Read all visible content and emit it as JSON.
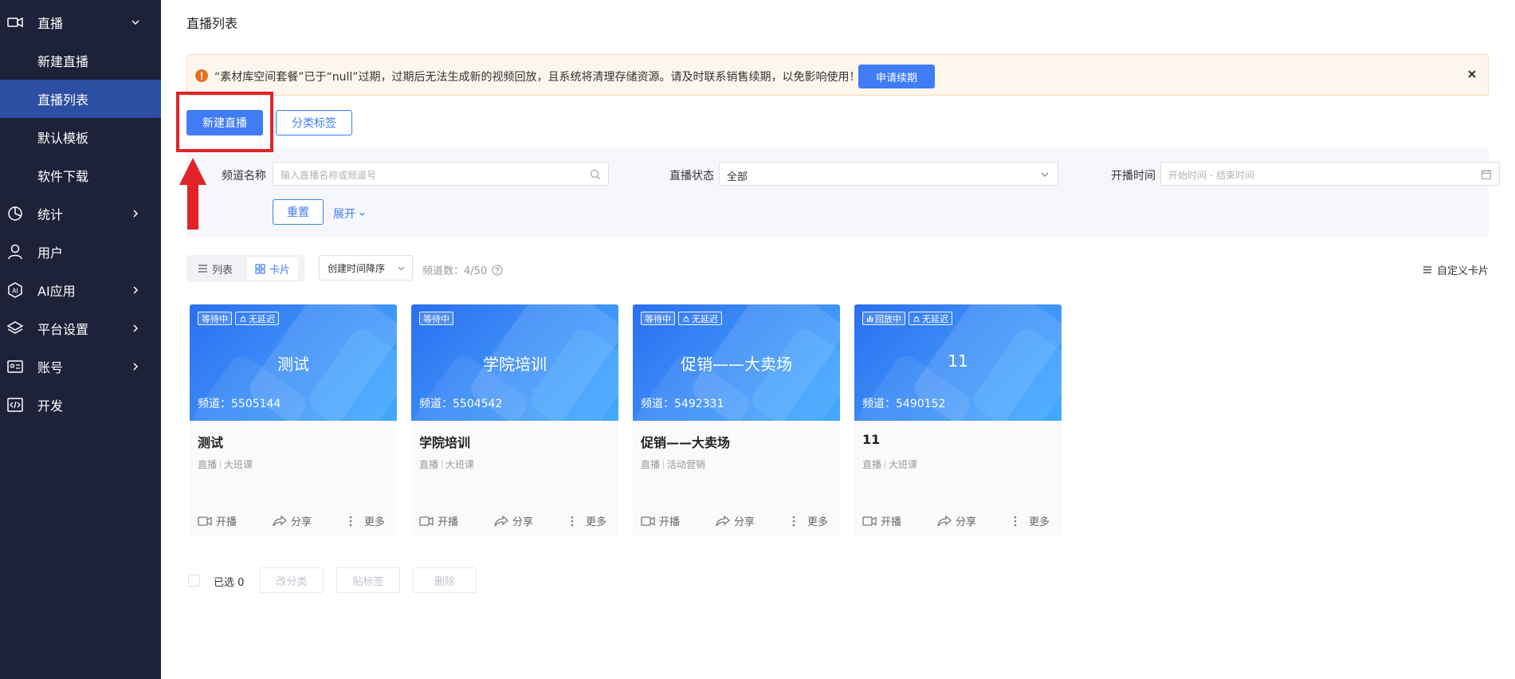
{
  "sidebar": {
    "items": [
      {
        "label": "直播",
        "icon": "video-camera-icon"
      },
      {
        "label": "新建直播"
      },
      {
        "label": "直播列表",
        "active": true
      },
      {
        "label": "默认模板"
      },
      {
        "label": "软件下载"
      },
      {
        "label": "统计",
        "icon": "pie-chart-icon"
      },
      {
        "label": "用户",
        "icon": "user-icon"
      },
      {
        "label": "AI应用",
        "icon": "ai-hexagon-icon"
      },
      {
        "label": "平台设置",
        "icon": "layers-icon"
      },
      {
        "label": "账号",
        "icon": "id-card-icon"
      },
      {
        "label": "开发",
        "icon": "code-icon"
      }
    ]
  },
  "page": {
    "title": "直播列表"
  },
  "alert": {
    "text": "“素材库空间套餐”已于“null”过期，过期后无法生成新的视频回放，且系统将清理存储资源。请及时联系销售续期，以免影响使用！",
    "renew_label": "申请续期",
    "close_icon": "close-icon"
  },
  "actions": {
    "new_live_label": "新建直播",
    "category_tags_label": "分类标签"
  },
  "filter": {
    "channel_name_label": "频道名称",
    "channel_name_placeholder": "输入直播名称或频道号",
    "status_label": "直播状态",
    "status_value": "全部",
    "start_time_label": "开播时间",
    "start_time_placeholder": "开始时间 - 结束时间",
    "reset_label": "重置",
    "expand_label": "展开"
  },
  "toolbar": {
    "list_label": "列表",
    "card_label": "卡片",
    "sort_value": "创建时间降序",
    "count_label": "频道数：4/50",
    "custom_card_label": "自定义卡片"
  },
  "cards": [
    {
      "status": "等待中",
      "latency": "无延迟",
      "cover_title": "测试",
      "channel": "频道：5505144",
      "name": "测试",
      "type": "直播",
      "scene": "大班课"
    },
    {
      "status": "等待中",
      "latency": "",
      "cover_title": "学院培训",
      "channel": "频道：5504542",
      "name": "学院培训",
      "type": "直播",
      "scene": "大班课"
    },
    {
      "status": "等待中",
      "latency": "无延迟",
      "cover_title": "促销——大卖场",
      "channel": "频道：5492331",
      "name": "促销——大卖场",
      "type": "直播",
      "scene": "活动营销"
    },
    {
      "status": "回放中",
      "latency": "无延迟",
      "cover_title": "11",
      "channel": "频道：5490152",
      "name": "11",
      "type": "直播",
      "scene": "大班课"
    }
  ],
  "card_actions": {
    "start_label": "开播",
    "share_label": "分享",
    "more_label": "更多"
  },
  "bottom": {
    "selected_label": "已选 0",
    "recategorize_label": "改分类",
    "tag_label": "贴标签",
    "delete_label": "删除"
  },
  "colors": {
    "sidebar_bg": "#1d2239",
    "sidebar_active": "#2c4ea3",
    "primary": "#3f7cf6",
    "alert_bg": "#fdf6ec",
    "highlight": "#e3222a"
  }
}
